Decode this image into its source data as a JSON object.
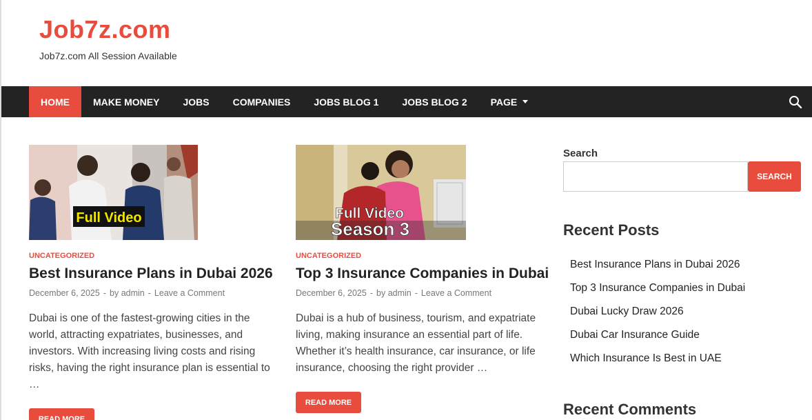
{
  "site": {
    "title": "Job7z.com",
    "tagline": "Job7z.com All Session Available"
  },
  "nav": {
    "items": [
      {
        "label": "HOME",
        "active": true
      },
      {
        "label": "MAKE MONEY"
      },
      {
        "label": "JOBS"
      },
      {
        "label": "COMPANIES"
      },
      {
        "label": "JOBS BLOG 1"
      },
      {
        "label": "JOBS BLOG 2"
      },
      {
        "label": "PAGE",
        "has_dropdown": true
      }
    ],
    "search_icon": "search-icon"
  },
  "posts": [
    {
      "thumbnail_caption": "Full Video",
      "category": "UNCATEGORIZED",
      "title": "Best Insurance Plans in Dubai 2026",
      "date": "December 6, 2025",
      "by": "by",
      "author": "admin",
      "comment_link": "Leave a Comment",
      "excerpt": "Dubai is one of the fastest-growing cities in the world, attracting expatriates, businesses, and investors. With increasing living costs and rising risks, having the right insurance plan is essential to …",
      "read_more": "READ MORE"
    },
    {
      "thumbnail_caption_line1": "Full Video",
      "thumbnail_caption_line2": "Season 3",
      "category": "UNCATEGORIZED",
      "title": "Top 3 Insurance Companies in Dubai",
      "date": "December 6, 2025",
      "by": "by",
      "author": "admin",
      "comment_link": "Leave a Comment",
      "excerpt": "Dubai is a hub of business, tourism, and expatriate living, making insurance an essential part of life. Whether it’s health insurance, car insurance, or life insurance, choosing the right provider …",
      "read_more": "READ MORE"
    }
  ],
  "sidebar": {
    "search": {
      "label": "Search",
      "value": "",
      "placeholder": "",
      "button": "SEARCH"
    },
    "recent_posts": {
      "title": "Recent Posts",
      "items": [
        "Best Insurance Plans in Dubai 2026",
        "Top 3 Insurance Companies in Dubai",
        "Dubai Lucky Draw 2026",
        "Dubai Car Insurance Guide",
        "Which Insurance Is Best in UAE"
      ]
    },
    "recent_comments": {
      "title": "Recent Comments"
    }
  },
  "colors": {
    "accent": "#e84c3d",
    "nav_bg": "#232323"
  }
}
